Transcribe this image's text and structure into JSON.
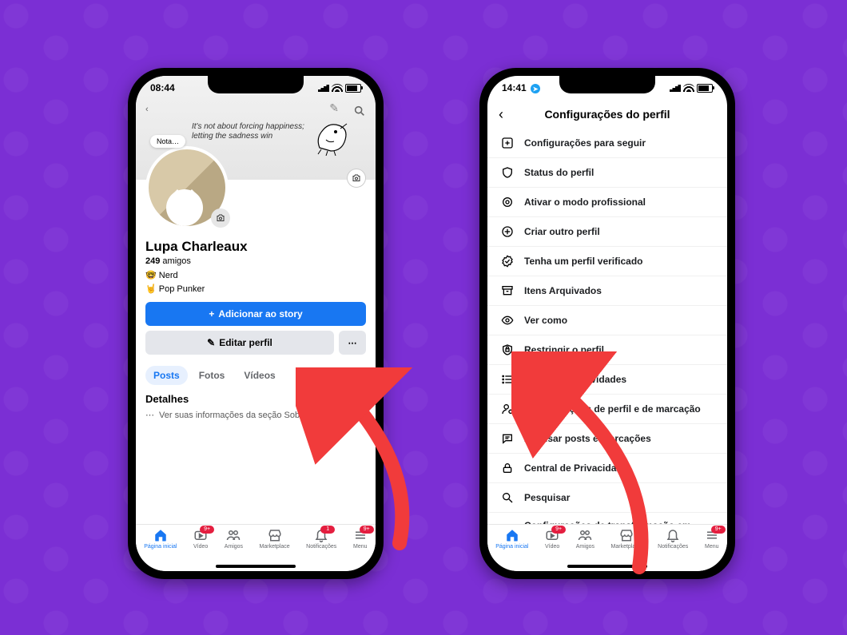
{
  "phone_left": {
    "status_time": "08:44",
    "cover_quote_line1": "It's not about forcing happiness;",
    "cover_quote_line2": "letting the sadness win",
    "note_label": "Nota…",
    "name": "Lupa Charleaux",
    "friends_count": "249",
    "friends_word": "amigos",
    "bio_line1": "🤓 Nerd",
    "bio_line2": "🤘 Pop Punker",
    "add_story_label": "Adicionar ao story",
    "edit_profile_label": "Editar perfil",
    "tabs": {
      "posts": "Posts",
      "photos": "Fotos",
      "videos": "Vídeos"
    },
    "details_title": "Detalhes",
    "about_more": "Ver suas informações da seção Sobre"
  },
  "phone_right": {
    "status_time": "14:41",
    "header_title": "Configurações do perfil",
    "items": [
      "Configurações para seguir",
      "Status do perfil",
      "Ativar o modo profissional",
      "Criar outro perfil",
      "Tenha um perfil verificado",
      "Itens Arquivados",
      "Ver como",
      "Restringir o perfil",
      "Registro de atividades",
      "Configurações de perfil e de marcação",
      "Analisar posts e marcações",
      "Central de Privacidade",
      "Pesquisar",
      "Configurações de transformação em memorial"
    ]
  },
  "tabbar": {
    "home": "Página inicial",
    "video": "Vídeo",
    "friends": "Amigos",
    "marketplace": "Marketplace",
    "notifications": "Notificações",
    "menu": "Menu",
    "badge9plus": "9+",
    "badge1": "1"
  }
}
